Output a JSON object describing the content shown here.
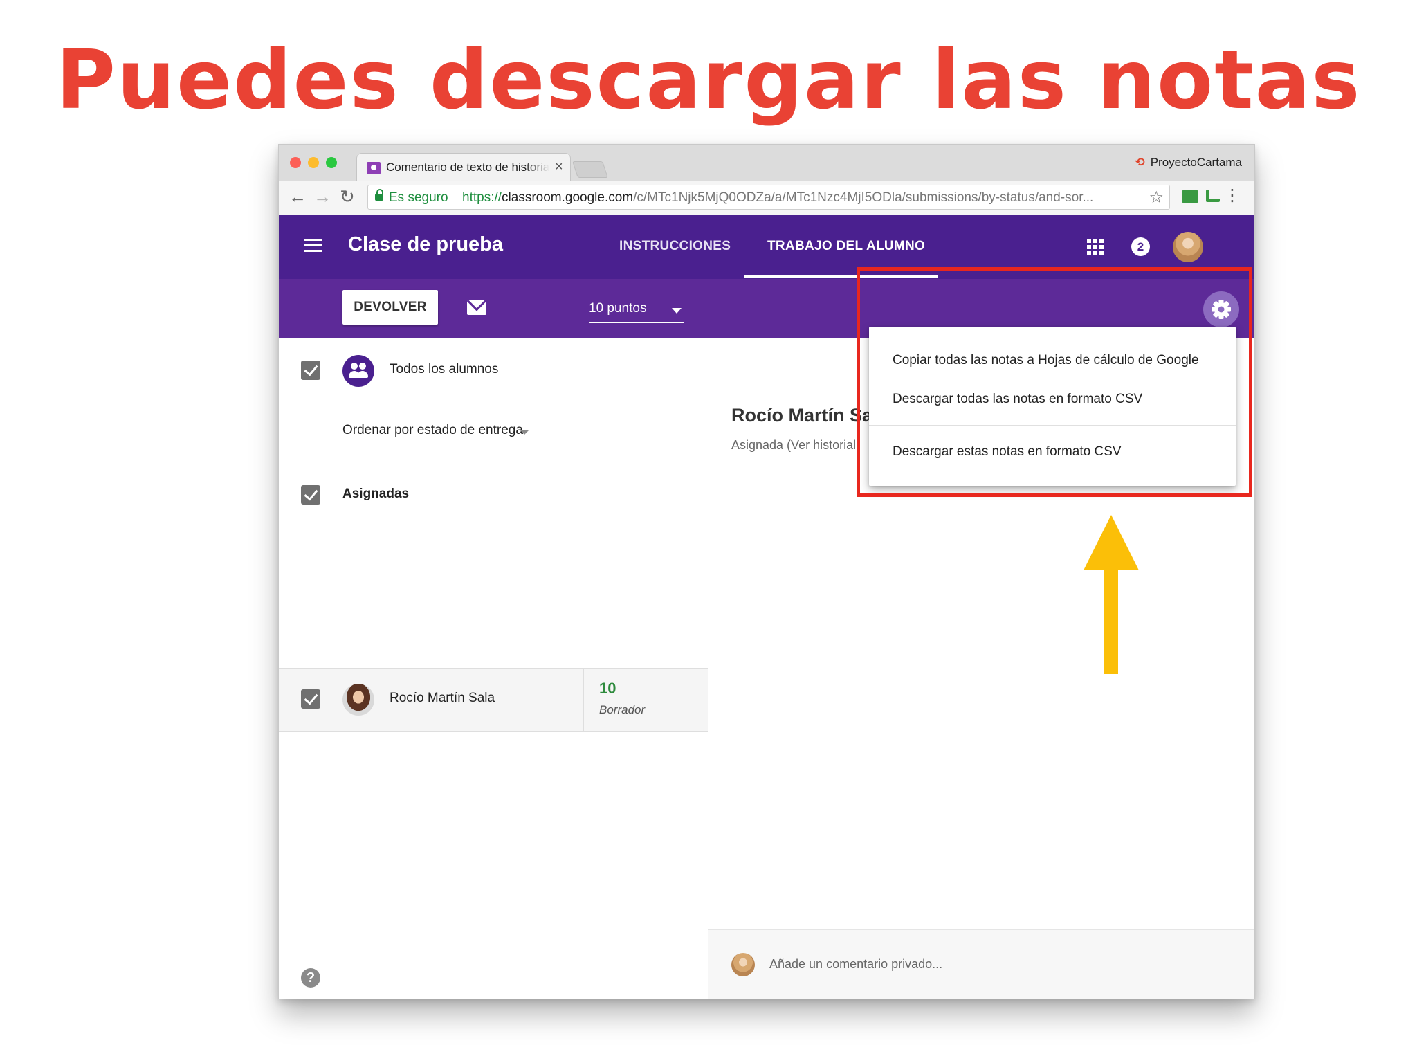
{
  "slide": {
    "title": "Puedes descargar las notas",
    "title_color": "#e94234"
  },
  "browser": {
    "tab_title": "Comentario de texto de historia",
    "tab_close": "×",
    "profile_name": "ProyectoCartama",
    "secure_label": "Es seguro",
    "url_scheme": "https://",
    "url_host": "classroom.google.com",
    "url_path": "/c/MTc1Njk5MjQ0ODZa/a/MTc1Nzc4MjI5ODla/submissions/by-status/and-sor...",
    "back_icon": "←",
    "forward_icon": "→",
    "reload_icon": "↻",
    "star_icon": "☆",
    "menu_icon": "⋮"
  },
  "app": {
    "class_title": "Clase de prueba",
    "tabs": [
      {
        "label": "INSTRUCCIONES"
      },
      {
        "label": "TRABAJO DEL ALUMNO"
      }
    ],
    "notification_count": "2",
    "header_color": "#4a208f",
    "action_bar_color": "#5d2a98"
  },
  "toolbar": {
    "return_label": "DEVOLVER",
    "points_label": "10 puntos"
  },
  "roster": {
    "all_students_label": "Todos los alumnos",
    "sort_label": "Ordenar por estado de entrega",
    "assigned_label": "Asignadas",
    "students": [
      {
        "name": "Rocío Martín Sala",
        "grade": "10",
        "status": "Borrador"
      }
    ],
    "help_icon": "?"
  },
  "detail": {
    "student_name": "Rocío Martín Sal",
    "status_line": "Asignada (Ver historial",
    "comment_placeholder": "Añade un comentario privado..."
  },
  "settings_menu": {
    "items": [
      {
        "label": "Copiar todas las notas a Hojas de cálculo de Google"
      },
      {
        "label": "Descargar todas las notas en formato CSV"
      },
      {
        "label": "Descargar estas notas en formato CSV"
      }
    ]
  },
  "annotation": {
    "box_color": "#e8271e",
    "arrow_color": "#fbbf08"
  }
}
